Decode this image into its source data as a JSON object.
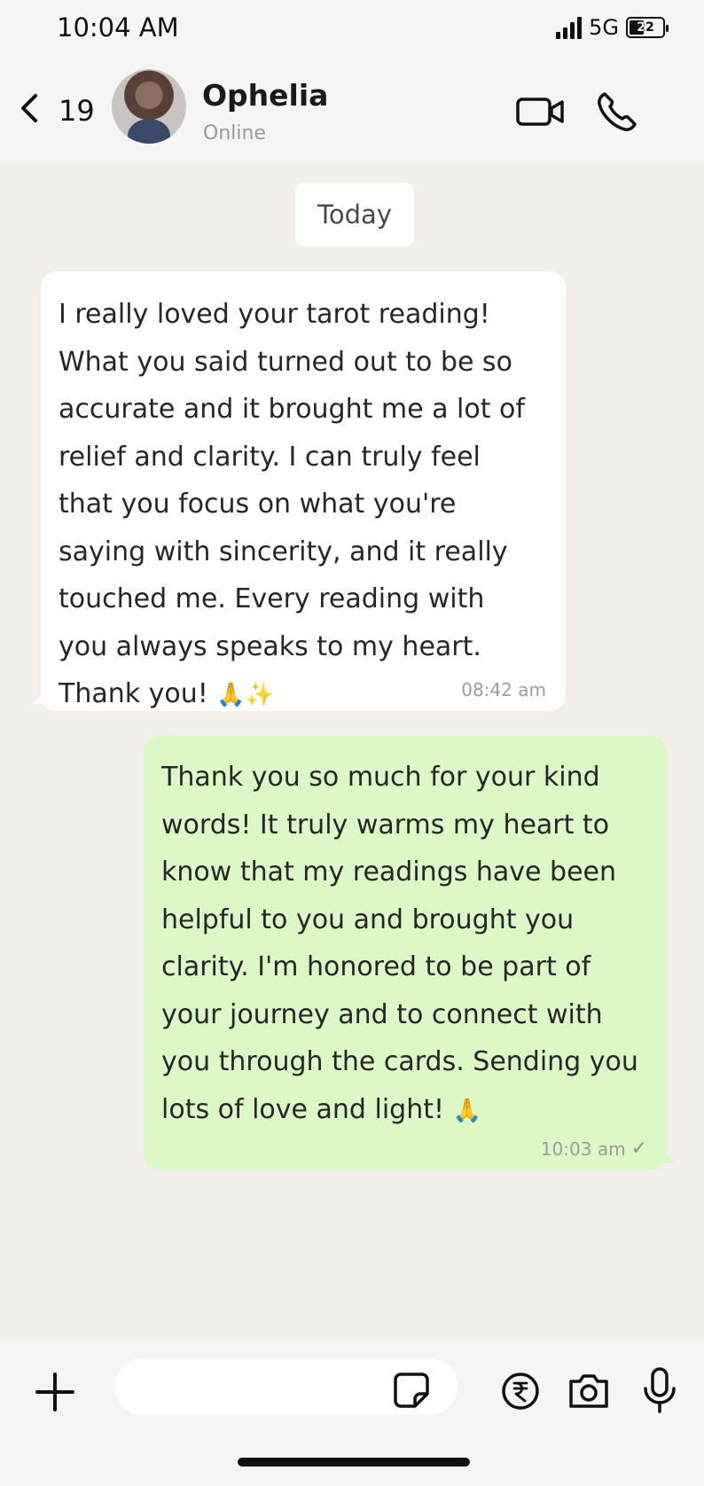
{
  "status_bar": {
    "time": "10:04 AM",
    "network": "5G",
    "battery": "22"
  },
  "header": {
    "unread_count": "19",
    "contact_name": "Ophelia",
    "contact_status": "Online",
    "icons": [
      "back-chevron-icon",
      "video-call-icon",
      "phone-call-icon"
    ]
  },
  "chat": {
    "date_divider": "Today",
    "messages": [
      {
        "direction": "incoming",
        "text": "I really loved your tarot reading!\nWhat you said turned out to be so\naccurate and it brought me a lot of\nrelief and clarity. I can truly feel\nthat you focus on what you're\nsaying with sincerity, and it really\ntouched me. Every reading with\nyou always speaks to my heart.\nThank you! ",
        "emoji": [
          "🙏",
          "✨"
        ],
        "time": "08:42 am"
      },
      {
        "direction": "outgoing",
        "text": "Thank you so much for your kind\nwords! It truly warms my heart to\nknow that my readings have been\nhelpful to you and brought you\nclarity. I'm honored to be part of\nyour journey and to connect with\nyou through the cards. Sending you\nlots of love and light! ",
        "emoji": [
          "🙏"
        ],
        "time": "10:03 am",
        "status": "✓"
      }
    ]
  },
  "composer": {
    "value": "",
    "icons": [
      "plus-icon",
      "sticker-icon",
      "rupee-payment-icon",
      "camera-icon",
      "microphone-icon"
    ]
  },
  "colors": {
    "chat_background": "#f3efea",
    "incoming_bubble": "#ffffff",
    "outgoing_bubble": "#dcf8c6",
    "header_background": "#f6f5f4"
  }
}
